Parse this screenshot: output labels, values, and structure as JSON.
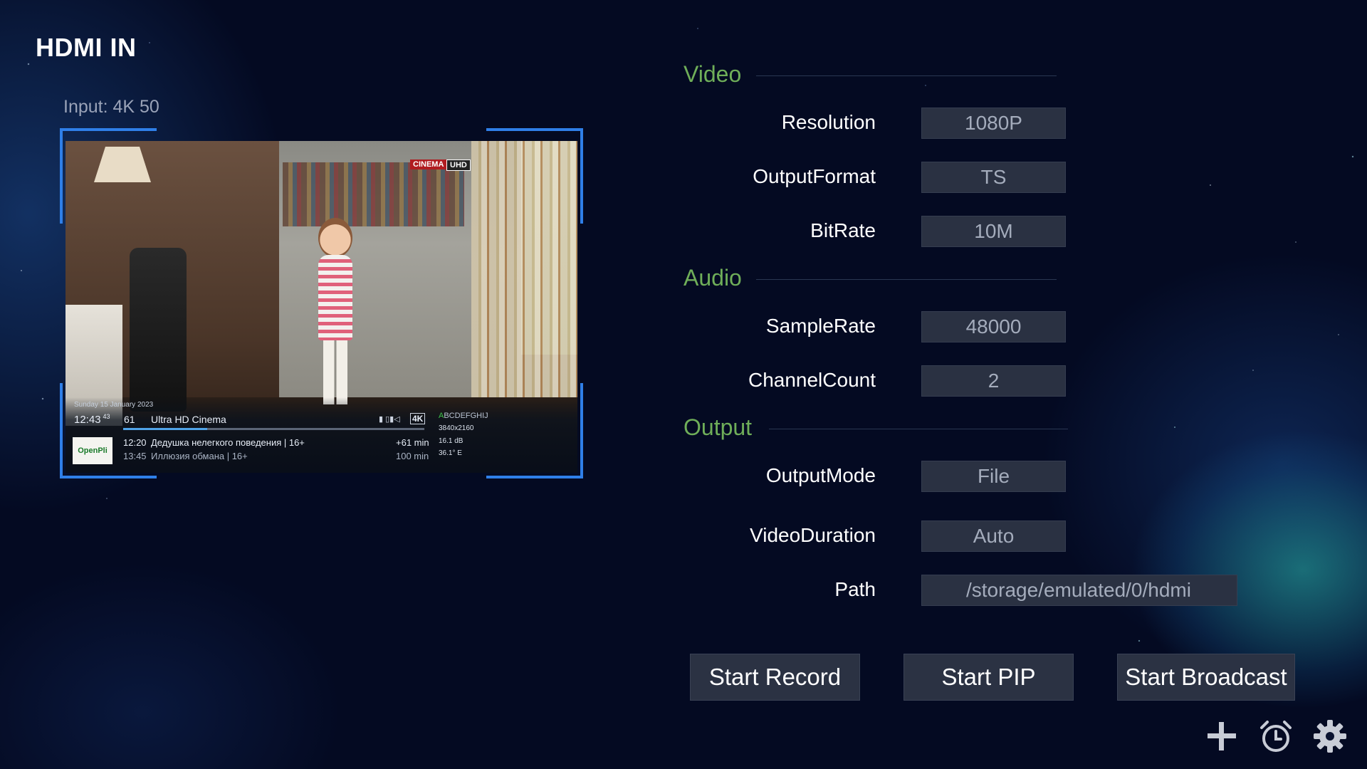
{
  "app": {
    "title": "HDMI IN",
    "input_label": "Input:  4K  50"
  },
  "preview": {
    "logos": {
      "cinema": "CINEMA",
      "uhd": "UHD"
    },
    "osd": {
      "date": "Sunday 15 January 2023",
      "time": "12:43",
      "time_seconds": "43",
      "channel_number": "61",
      "channel_name": "Ultra HD Cinema",
      "format_badge": "4K",
      "icons_text": "▮ ▯▮◁",
      "progress_fraction": 0.28,
      "satellite_letters_highlight": "A",
      "satellite_letters_rest": "BCDEFGHIJ",
      "resolution": "3840x2160",
      "signal": "16.1 dB",
      "position": "36.1° E",
      "channel_logo": "OpenPli",
      "event_now": {
        "time": "12:20",
        "title": "Дедушка нелегкого поведения | 16+",
        "remaining": "+61 min"
      },
      "event_next": {
        "time": "13:45",
        "title": "Иллюзия обмана | 16+",
        "duration": "100 min"
      }
    }
  },
  "sections": {
    "video": {
      "title": "Video",
      "fields": {
        "resolution": {
          "label": "Resolution",
          "value": "1080P"
        },
        "output_format": {
          "label": "OutputFormat",
          "value": "TS"
        },
        "bitrate": {
          "label": "BitRate",
          "value": "10M"
        }
      }
    },
    "audio": {
      "title": "Audio",
      "fields": {
        "sample_rate": {
          "label": "SampleRate",
          "value": "48000"
        },
        "channel_count": {
          "label": "ChannelCount",
          "value": "2"
        }
      }
    },
    "output": {
      "title": "Output",
      "fields": {
        "output_mode": {
          "label": "OutputMode",
          "value": "File"
        },
        "video_duration": {
          "label": "VideoDuration",
          "value": "Auto"
        },
        "path": {
          "label": "Path",
          "value": "/storage/emulated/0/hdmi"
        }
      }
    }
  },
  "buttons": {
    "start_record": "Start Record",
    "start_pip": "Start PIP",
    "start_broadcast": "Start Broadcast"
  },
  "toolbar": {
    "icons": [
      "plus-icon",
      "alarm-clock-icon",
      "gear-icon"
    ]
  },
  "colors": {
    "section_title": "#6fae59",
    "frame_accent": "#2f7fe8",
    "field_bg": "#2a3142",
    "background": "#040a22"
  }
}
